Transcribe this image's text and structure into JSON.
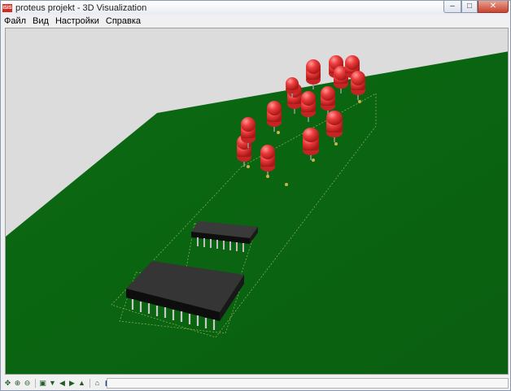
{
  "window": {
    "app_icon_text": "ISIS",
    "title": "proteus projekt - 3D Visualization",
    "controls": {
      "minimize_icon": "minimize-icon",
      "maximize_icon": "maximize-icon",
      "close_icon": "close-icon"
    }
  },
  "menu": [
    "Файл",
    "Вид",
    "Настройки",
    "Справка"
  ],
  "scene": {
    "background_color": "#dcdcdc",
    "board_color": "#0b6611",
    "led_color": "#e83434",
    "led_count": 15,
    "components": [
      "14-pin DIP IC",
      "24-pin DIP IC",
      "LED array"
    ]
  },
  "toolbar": [
    "navigate-icon",
    "zoom-in-icon",
    "zoom-out-icon",
    "top-view-icon",
    "front-view-icon",
    "left-view-icon",
    "right-view-icon",
    "back-view-icon",
    "home-view-icon",
    "layer-icon"
  ],
  "status": {
    "text": ""
  }
}
